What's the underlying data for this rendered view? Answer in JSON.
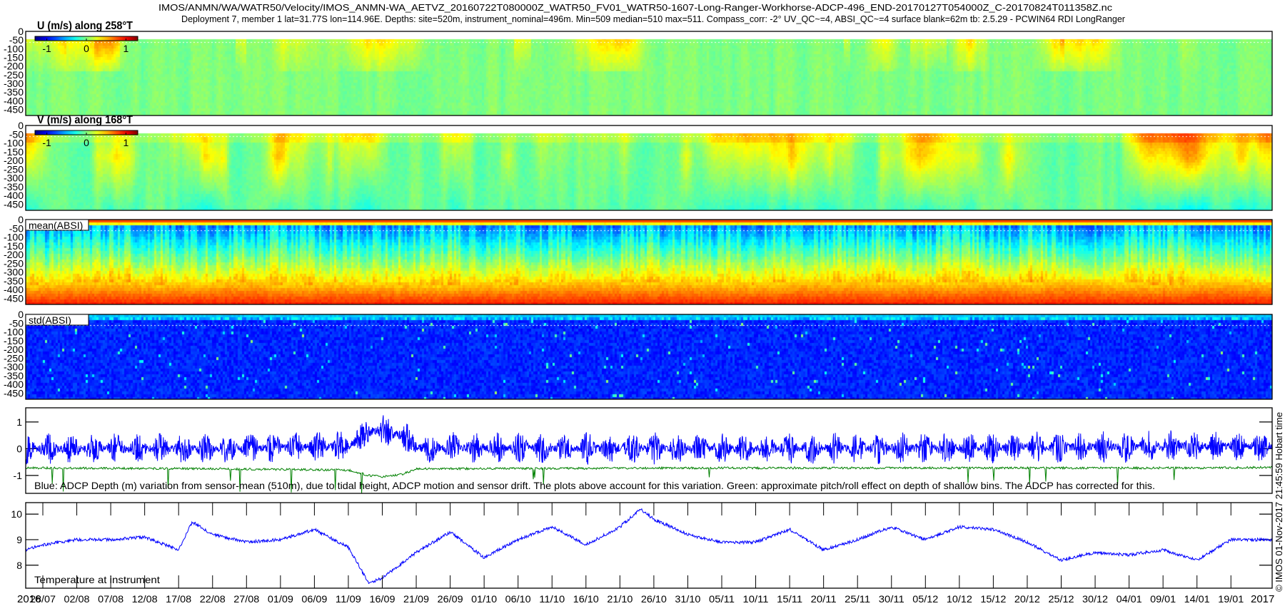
{
  "title": {
    "line1": "IMOS/ANMN/WA/WATR50/Velocity/IMOS_ANMN-WA_AETVZ_20160722T080000Z_WATR50_FV01_WATR50-1607-Long-Ranger-Workhorse-ADCP-496_END-20170127T054000Z_C-20170824T011358Z.nc",
    "line2": "Deployment 7, member 1 lat=31.77S lon=114.96E. Depths: site=520m, instrument_nominal=496m. Min=509 median=510 max=511. Compass_corr: -2° UV_QC~=4, ABSI_QC~=4 surface blank=62m tb: 2.5.29 - PCWIN64 RDI LongRanger"
  },
  "stamp": "© IMOS 01-Nov-2017 21:45:59 Hobart time",
  "x_axis": {
    "year_start": "2016",
    "year_end": "2017",
    "tick_day_step": 5,
    "ticks": [
      "28/07",
      "02/08",
      "07/08",
      "12/08",
      "17/08",
      "22/08",
      "27/08",
      "01/09",
      "06/09",
      "11/09",
      "16/09",
      "21/09",
      "26/09",
      "01/10",
      "06/10",
      "11/10",
      "16/10",
      "21/10",
      "26/10",
      "31/10",
      "05/11",
      "10/11",
      "15/11",
      "20/11",
      "25/11",
      "30/11",
      "05/12",
      "10/12",
      "15/12",
      "20/12",
      "25/12",
      "30/12",
      "04/01",
      "09/01",
      "14/01",
      "19/01"
    ],
    "range_days_from_first_tick": [
      -2.5,
      181.1
    ]
  },
  "chart_data": [
    {
      "id": "u",
      "type": "heatmap",
      "title": "U (m/s) along 258°T",
      "ylim": [
        -485,
        0
      ],
      "yticks": [
        "0",
        "-50",
        "-100",
        "-150",
        "-200",
        "-250",
        "-300",
        "-350",
        "-400",
        "-450"
      ],
      "clim": [
        -1.3,
        1.3
      ],
      "colorbar_ticks": [
        "-1",
        "0",
        "1"
      ],
      "surface_blank_m": 62,
      "colormap": "jet"
    },
    {
      "id": "v",
      "type": "heatmap",
      "title": "V (m/s) along 168°T",
      "ylim": [
        -485,
        0
      ],
      "yticks": [
        "0",
        "-50",
        "-100",
        "-150",
        "-200",
        "-250",
        "-300",
        "-350",
        "-400",
        "-450"
      ],
      "clim": [
        -1.3,
        1.3
      ],
      "colorbar_ticks": [
        "-1",
        "0",
        "1"
      ],
      "surface_blank_m": 62,
      "colormap": "jet"
    },
    {
      "id": "mean",
      "type": "heatmap",
      "title": "mean(ABSI)",
      "ylim": [
        -485,
        0
      ],
      "yticks": [
        "0",
        "-50",
        "-100",
        "-150",
        "-200",
        "-250",
        "-300",
        "-350",
        "-400",
        "-450"
      ],
      "surface_blank_m": 62,
      "colormap": "jet"
    },
    {
      "id": "std",
      "type": "heatmap",
      "title": "std(ABSI)",
      "ylim": [
        -485,
        0
      ],
      "yticks": [
        "0",
        "-50",
        "-100",
        "-150",
        "-200",
        "-250",
        "-300",
        "-350",
        "-400",
        "-450"
      ],
      "surface_blank_m": 62,
      "colormap": "jet"
    },
    {
      "id": "depth",
      "type": "line",
      "ylim": [
        -1.67,
        1.53
      ],
      "yticks": [
        "1",
        "0",
        "-1"
      ],
      "ytick_values": [
        1,
        0,
        -1
      ],
      "caption": "Blue: ADCP Depth (m) variation from sensor-mean (510m), due to tidal height, ADCP motion and sensor drift. The plots above account for this variation. Green: approximate pitch/roll effect on depth of shallow bins. The ADCP has corrected for this.",
      "x_days": [
        -2.5,
        0,
        25,
        45,
        48,
        50,
        53,
        55,
        100,
        150,
        170,
        181.1
      ],
      "series": [
        {
          "name": "ADCP depth variation",
          "color": "#0000ff",
          "mean": [
            0,
            0,
            0,
            0.1,
            0.65,
            0.7,
            0.5,
            0.05,
            0,
            0.05,
            0.1,
            0.1
          ],
          "amplitude": 0.6
        },
        {
          "name": "pitch/roll effect",
          "color": "#008000",
          "mean": [
            -0.72,
            -0.72,
            -0.75,
            -0.8,
            -1.0,
            -1.05,
            -0.95,
            -0.75,
            -0.72,
            -0.72,
            -0.72,
            -0.7
          ],
          "amplitude": 0.08
        }
      ]
    },
    {
      "id": "temp",
      "type": "line",
      "label": "Temperature at instrument",
      "ylim": [
        7.1,
        10.45
      ],
      "yticks": [
        "10",
        "9",
        "8"
      ],
      "ytick_values": [
        10,
        9,
        8
      ],
      "series": [
        {
          "name": "Temperature",
          "color": "#0000ff",
          "x_days": [
            -2.5,
            0,
            5,
            10,
            15,
            20,
            22,
            25,
            30,
            35,
            40,
            45,
            48,
            50,
            55,
            60,
            65,
            70,
            75,
            80,
            85,
            88,
            90,
            95,
            100,
            105,
            110,
            115,
            120,
            125,
            130,
            135,
            140,
            145,
            150,
            155,
            160,
            165,
            170,
            175,
            181.1
          ],
          "values": [
            8.6,
            8.8,
            9.0,
            9.0,
            9.1,
            8.6,
            9.7,
            9.2,
            8.9,
            9.0,
            9.4,
            8.7,
            7.3,
            7.5,
            8.5,
            9.3,
            8.3,
            9.0,
            9.5,
            8.8,
            9.5,
            10.2,
            9.8,
            9.2,
            8.9,
            8.9,
            9.4,
            8.6,
            9.0,
            9.5,
            9.0,
            9.5,
            9.4,
            8.9,
            8.2,
            8.5,
            8.4,
            8.6,
            8.2,
            9.0,
            9.0
          ]
        }
      ]
    }
  ]
}
